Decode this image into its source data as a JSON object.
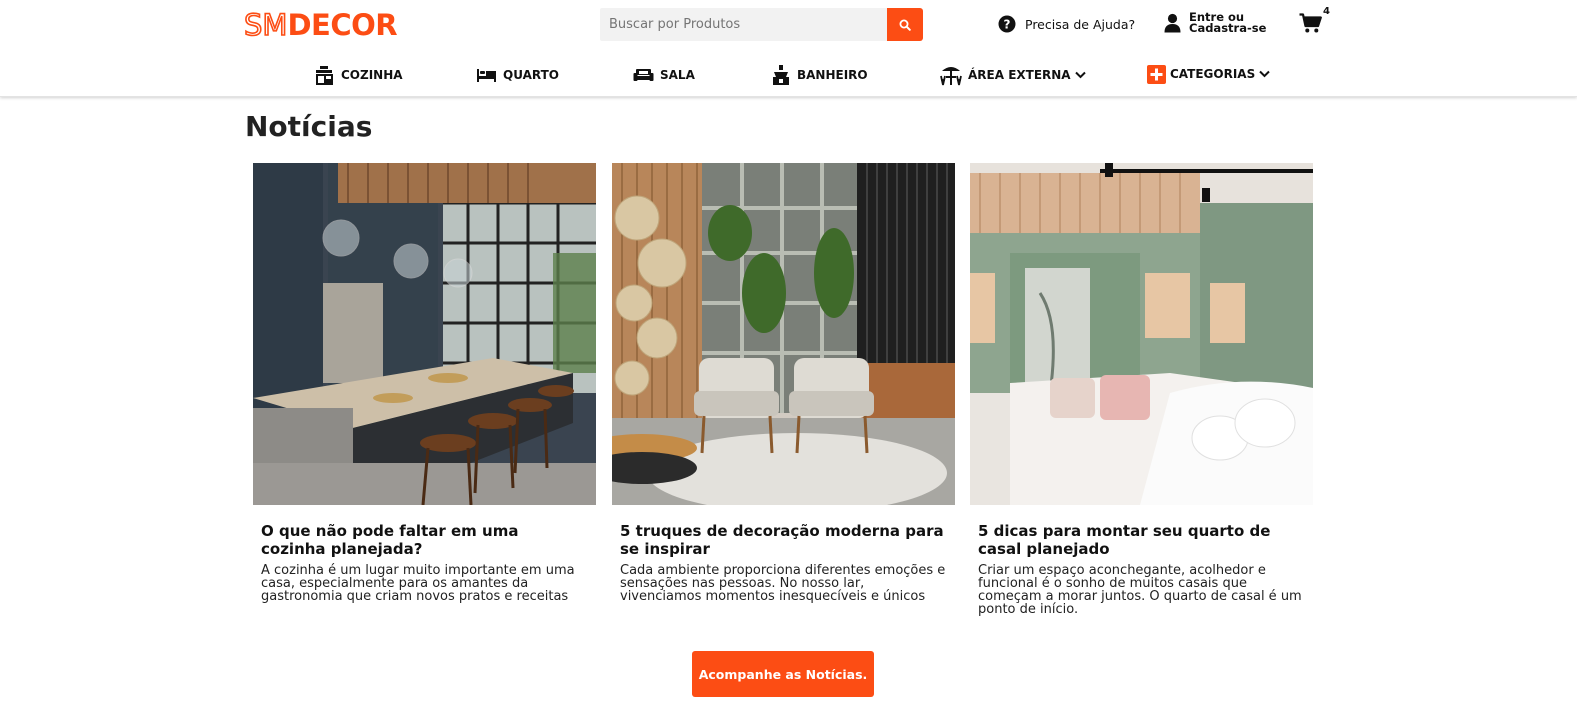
{
  "brand": {
    "logo_sm": "SM",
    "logo_decor": "DECOR",
    "accent": "#fc4d14"
  },
  "search": {
    "placeholder": "Buscar por Produtos",
    "button_icon": "search-icon"
  },
  "help": {
    "label": "Precisa de Ajuda?",
    "icon": "question-circle-icon"
  },
  "account": {
    "label": "Entre ou Cadastra-se",
    "icon": "user-icon"
  },
  "cart": {
    "count": "4",
    "icon": "cart-icon"
  },
  "nav": {
    "items": [
      {
        "label": "COZINHA",
        "icon": "kitchen-icon"
      },
      {
        "label": "QUARTO",
        "icon": "bed-icon"
      },
      {
        "label": "SALA",
        "icon": "sofa-icon"
      },
      {
        "label": "BANHEIRO",
        "icon": "bathroom-icon"
      },
      {
        "label": "ÁREA EXTERNA",
        "icon": "outdoor-icon"
      },
      {
        "label": "CATEGORIAS",
        "icon": "plus-square-icon"
      }
    ]
  },
  "page": {
    "title": "Notícias"
  },
  "articles": [
    {
      "title": "O que não pode faltar em uma cozinha planejada?",
      "description": "A cozinha é um lugar muito importante em uma casa, especialmente para os amantes da gastronomia que criam novos pratos e receitas"
    },
    {
      "title": "5 truques de decoração moderna para se inspirar",
      "description": "Cada ambiente proporciona diferentes emoções e sensações nas pessoas. No nosso lar, vivenciamos momentos inesquecíveis e únicos"
    },
    {
      "title": "5 dicas para montar seu quarto de casal planejado",
      "description": "Criar um espaço aconchegante, acolhedor e funcional é o sonho de muitos casais que começam a morar juntos. O quarto de casal é um ponto de início."
    }
  ],
  "cta": {
    "label": "Acompanhe as Notícias."
  }
}
